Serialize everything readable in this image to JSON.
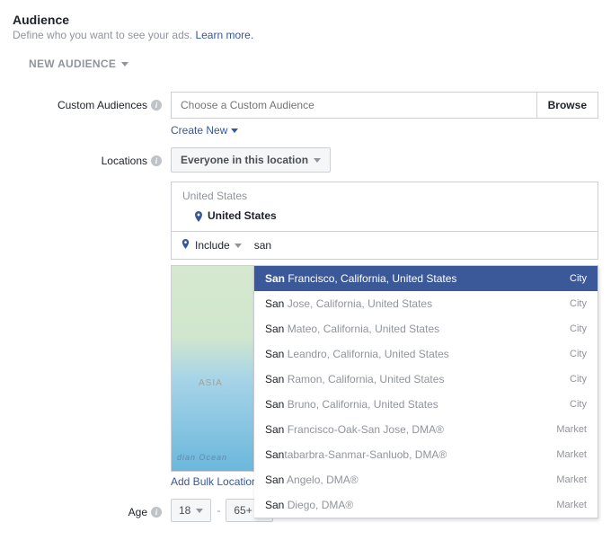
{
  "header": {
    "title": "Audience",
    "subtitle_text": "Define who you want to see your ads. ",
    "learn_more": "Learn more."
  },
  "tab": {
    "label": "NEW AUDIENCE"
  },
  "custom_audiences": {
    "label": "Custom Audiences",
    "placeholder": "Choose a Custom Audience",
    "browse": "Browse",
    "create_new": "Create New"
  },
  "locations": {
    "label": "Locations",
    "scope": "Everyone in this location",
    "country_header": "United States",
    "selected": "United States",
    "include_label": "Include",
    "search_value": "san",
    "map_region": "ASIA",
    "map_ocean": "dian Ocean",
    "add_bulk": "Add Bulk Location",
    "suggestions": [
      {
        "match": "San",
        "rest": " Francisco, California, United States",
        "type": "City",
        "active": true
      },
      {
        "match": "San",
        "rest": " Jose, California, United States",
        "type": "City"
      },
      {
        "match": "San",
        "rest": " Mateo, California, United States",
        "type": "City"
      },
      {
        "match": "San",
        "rest": " Leandro, California, United States",
        "type": "City"
      },
      {
        "match": "San",
        "rest": " Ramon, California, United States",
        "type": "City"
      },
      {
        "match": "San",
        "rest": " Bruno, California, United States",
        "type": "City"
      },
      {
        "match": "San",
        "rest": " Francisco-Oak-San Jose, DMA®",
        "type": "Market"
      },
      {
        "match": "San",
        "rest": "tabarbra-Sanmar-Sanluob, DMA®",
        "type": "Market"
      },
      {
        "match": "San",
        "rest": " Angelo, DMA®",
        "type": "Market"
      },
      {
        "match": "San",
        "rest": " Diego, DMA®",
        "type": "Market"
      }
    ]
  },
  "age": {
    "label": "Age",
    "min": "18",
    "max": "65+"
  }
}
